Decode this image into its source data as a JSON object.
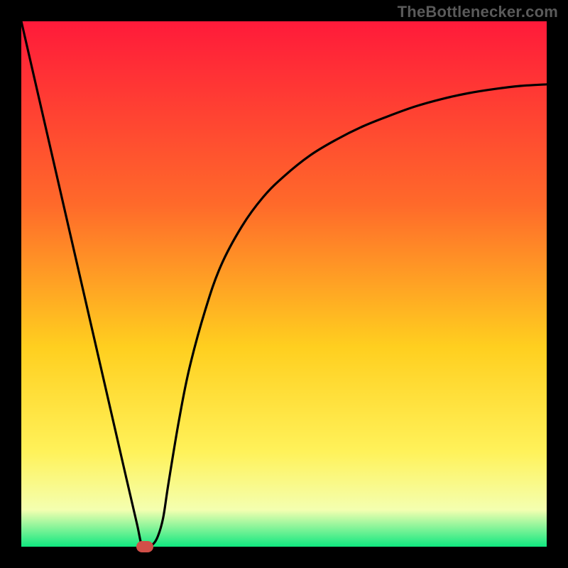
{
  "watermark": {
    "text": "TheBottlenecker.com"
  },
  "colors": {
    "gradient_top": "#ff1a3a",
    "gradient_mid_upper": "#ff6a2a",
    "gradient_mid": "#ffcf1f",
    "gradient_mid_lower": "#fff25a",
    "gradient_low": "#f4ffb0",
    "gradient_bottom": "#10e880",
    "curve": "#000000",
    "marker": "#d14f48",
    "frame": "#000000"
  },
  "chart_data": {
    "type": "line",
    "title": "",
    "xlabel": "",
    "ylabel": "",
    "xlim": [
      0,
      100
    ],
    "ylim": [
      0,
      100
    ],
    "grid": false,
    "legend": false,
    "x": [
      0,
      2,
      4,
      6,
      8,
      10,
      12,
      14,
      16,
      18,
      20,
      22,
      23,
      24,
      25,
      26,
      27,
      28,
      30,
      32,
      35,
      38,
      42,
      46,
      50,
      55,
      60,
      65,
      70,
      75,
      80,
      85,
      90,
      95,
      100
    ],
    "series": [
      {
        "name": "bottleneck-curve",
        "values": [
          100,
          91.3,
          82.6,
          73.9,
          65.2,
          56.5,
          47.8,
          39.1,
          30.4,
          21.7,
          13.0,
          4.4,
          0.0,
          0.0,
          0.4,
          2.0,
          5.5,
          12.0,
          24.0,
          34.0,
          45.0,
          53.5,
          61.0,
          66.5,
          70.5,
          74.5,
          77.5,
          80.0,
          82.0,
          83.8,
          85.2,
          86.3,
          87.1,
          87.7,
          88.0
        ]
      }
    ],
    "marker": {
      "x": 23.5,
      "y": 0
    }
  }
}
